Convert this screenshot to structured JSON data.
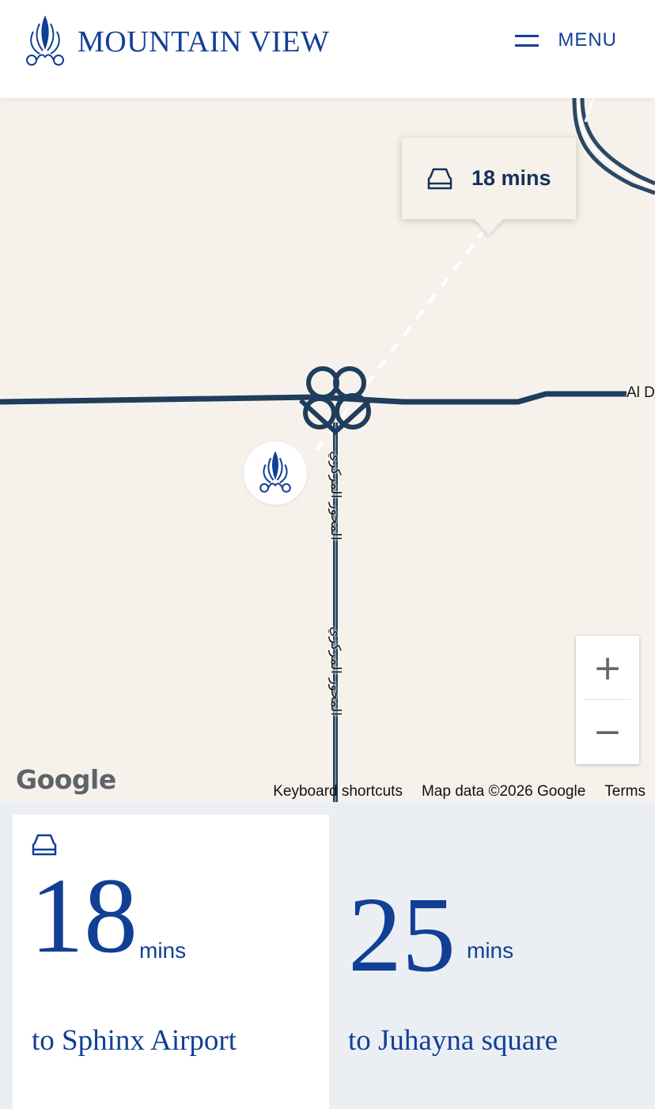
{
  "header": {
    "brand_name": "MOUNTAIN VIEW",
    "menu_label": "MENU"
  },
  "map": {
    "route_time": "18 mins",
    "road_label_1": "المحور المركزي",
    "road_label_2": "المحور المركزي",
    "road_label_east": "Al D",
    "zoom_in": "+",
    "zoom_out": "−",
    "google_logo": "Google",
    "footer": {
      "keyboard_shortcuts": "Keyboard shortcuts",
      "map_data": "Map data ©2026 Google",
      "terms": "Terms"
    }
  },
  "stats": [
    {
      "value": "18",
      "unit": "mins",
      "destination": "to Sphinx Airport",
      "icon": "car-icon"
    },
    {
      "value": "25",
      "unit": "mins",
      "destination": "to Juhayna square"
    }
  ],
  "colors": {
    "brand_blue": "#123f96",
    "road_dark": "#1f3d5c",
    "map_bg": "#f6f2eb",
    "stats_bg": "#ebeff4"
  }
}
